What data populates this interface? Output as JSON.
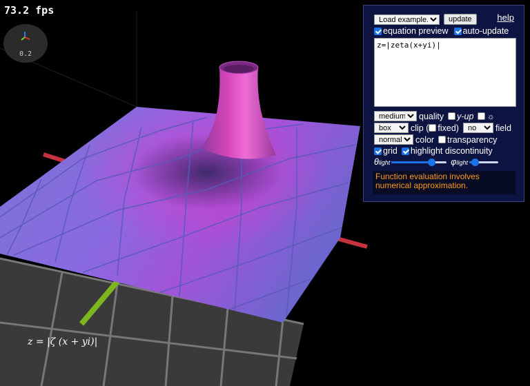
{
  "fps": "73.2 fps",
  "gizmo": {
    "scale": "0.2"
  },
  "formula": "z = |ζ (x + yi)|",
  "panel": {
    "load_example": "Load example...",
    "update_label": "update",
    "help_label": "help",
    "equation_preview_label": "equation preview",
    "equation_preview_checked": true,
    "auto_update_label": "auto-update",
    "auto_update_checked": true,
    "equation_text": "z=|zeta(x+yi)|",
    "quality_value": "medium",
    "quality_label": "quality",
    "y_up_label": "y-up",
    "y_up_checked": false,
    "light_label": "☼",
    "light_checked": false,
    "clip_value": "box",
    "clip_label": "clip (",
    "fixed_label": "fixed)",
    "fixed_checked": false,
    "field_value": "no",
    "field_label": "field",
    "color_value": "normal",
    "color_label": "color",
    "transparency_label": "transparency",
    "transparency_checked": false,
    "grid_label": "grid",
    "grid_checked": true,
    "highlight_label": "highlight discontinuity",
    "highlight_checked": true,
    "theta_symbol": "θ",
    "theta_sub": "light",
    "theta_level": 0.72,
    "phi_symbol": "φ",
    "phi_sub": "light",
    "phi_level": 0.18,
    "warning": "Function evaluation involves numerical approximation."
  },
  "colors": {
    "panel_bg": "#0e1442",
    "accent": "#1a73e8",
    "warning": "#ff9a1f"
  }
}
